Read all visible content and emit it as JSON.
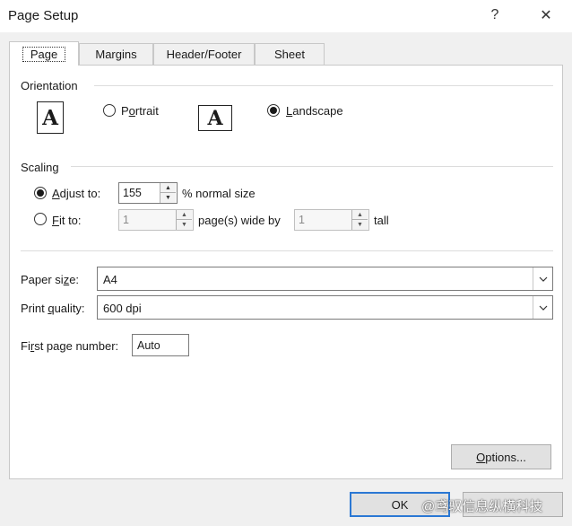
{
  "window": {
    "title": "Page Setup",
    "help_glyph": "?",
    "close_glyph": "✕"
  },
  "tabs": [
    {
      "label": "Page",
      "active": true
    },
    {
      "label": "Margins",
      "active": false
    },
    {
      "label": "Header/Footer",
      "active": false
    },
    {
      "label": "Sheet",
      "active": false
    }
  ],
  "orientation": {
    "section_label": "Orientation",
    "portrait": {
      "icon_letter": "A",
      "label_first": "P",
      "label_accel": "o",
      "label_rest": "rtrait",
      "selected": false
    },
    "landscape": {
      "icon_letter": "A",
      "label_accel": "L",
      "label_rest": "andscape",
      "selected": true
    }
  },
  "scaling": {
    "section_label": "Scaling",
    "adjust_to": {
      "label_accel": "A",
      "label_rest": "djust to:",
      "value": "155",
      "suffix": "% normal size",
      "selected": true
    },
    "fit_to": {
      "label_accel": "F",
      "label_rest": "it to:",
      "pages_wide": "1",
      "wide_label": "page(s) wide by",
      "pages_tall": "1",
      "tall_label": "tall",
      "selected": false
    }
  },
  "paper_size": {
    "label_a": "Paper si",
    "label_accel": "z",
    "label_b": "e:",
    "value": "A4"
  },
  "print_quality": {
    "label_a": "Print ",
    "label_accel": "q",
    "label_b": "uality:",
    "value": "600 dpi"
  },
  "first_page_number": {
    "label_a": "Fi",
    "label_accel": "r",
    "label_b": "st page number:",
    "value": "Auto"
  },
  "buttons": {
    "options_accel": "O",
    "options_rest": "ptions...",
    "ok": "OK",
    "cancel": ""
  },
  "watermark": "@鸢驭信息纵横科技",
  "colors": {
    "accent": "#2b78d4",
    "panel_bg": "#ffffff",
    "dialog_bg": "#f0f0f0"
  }
}
